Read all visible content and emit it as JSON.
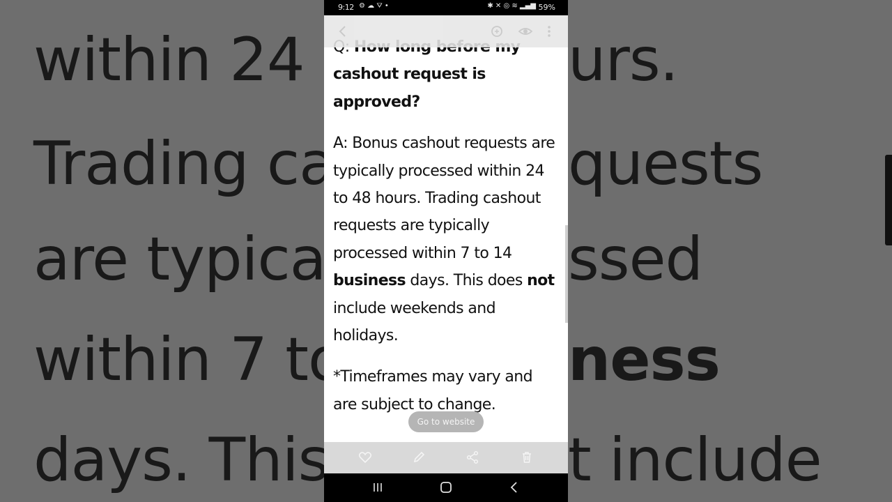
{
  "background": {
    "lines": [
      "within 24 t",
      "urs.",
      "Trading ca",
      "quests",
      "are typica",
      "ssed",
      "within 7 to",
      "ness",
      "days. This",
      "t include"
    ]
  },
  "status_bar": {
    "time": "9:12",
    "left_icons": "⚙ ☁ ⛛ •",
    "right_icons": "✱ ✕ ◎ ≋ ▂▄▆",
    "battery": "59%"
  },
  "topbar": {
    "icons": [
      "back-icon",
      "scan-icon",
      "eye-icon",
      "more-icon"
    ]
  },
  "content": {
    "question_prefix": "Q: ",
    "question": "How long before my cashout request is approved?",
    "answer_part1": "A: Bonus cashout requests are typically processed within 24 to 48 hours. Trading cashout requests are typically processed within 7 to 14 ",
    "answer_bold1": "business",
    "answer_part2": " days. This does ",
    "answer_bold2": "not",
    "answer_part3": " include weekends and holidays.",
    "note": "*Timeframes may vary and are subject to change."
  },
  "goto_button": {
    "label": "Go to website"
  },
  "bottombar": {
    "icons": [
      "heart-icon",
      "pencil-icon",
      "share-icon",
      "trash-icon"
    ]
  },
  "navbar": {
    "icons": [
      "recents-icon",
      "home-icon",
      "back-nav-icon"
    ]
  },
  "colors": {
    "background": "#737373",
    "page": "#ffffff",
    "topbar": "#e7e7e7",
    "bottombar": "#d9d9d9",
    "goto_button": "#b5b5b5",
    "system_bar": "#000000"
  }
}
